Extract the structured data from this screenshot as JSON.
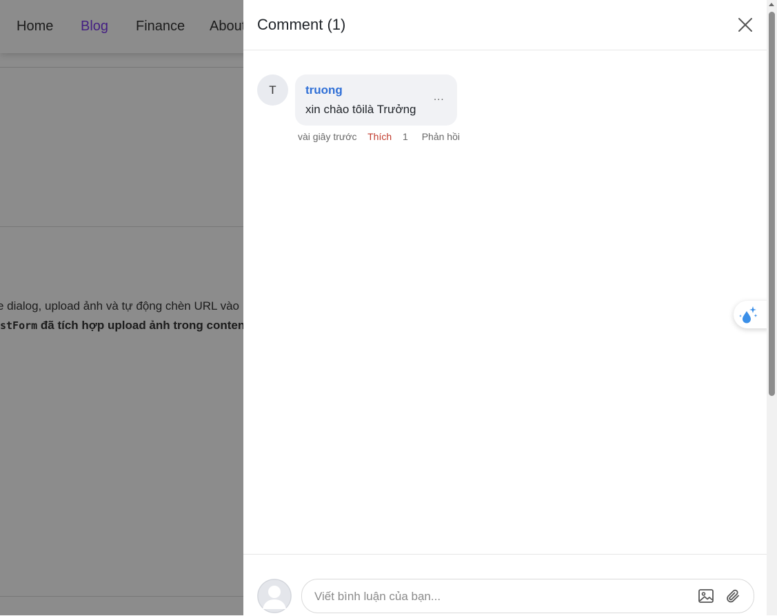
{
  "nav": {
    "items": [
      "Home",
      "Blog",
      "Finance",
      "About"
    ],
    "active": "Blog"
  },
  "background_content": {
    "line1": "e dialog, upload ảnh và tự động chèn URL vào",
    "line2_code": "stForm",
    "line2_text": " đã tích hợp upload ảnh trong conten"
  },
  "drawer": {
    "title": "Comment (1)",
    "close_icon": "close-icon"
  },
  "comments": [
    {
      "avatar_initial": "T",
      "author": "truong",
      "text": "xin chào tôilà Trưởng",
      "more": "...",
      "time": "vài giây trước",
      "like_label": "Thích",
      "like_count": "1",
      "reply_label": "Phản hồi"
    }
  ],
  "composer": {
    "placeholder": "Viết bình luận của bạn...",
    "image_icon": "image-icon",
    "attach_icon": "paperclip-icon"
  },
  "colors": {
    "active_nav": "#7c3aed",
    "author": "#2f6fd6",
    "like": "#c0392b",
    "overlay": "rgba(0,0,0,0.45)"
  }
}
